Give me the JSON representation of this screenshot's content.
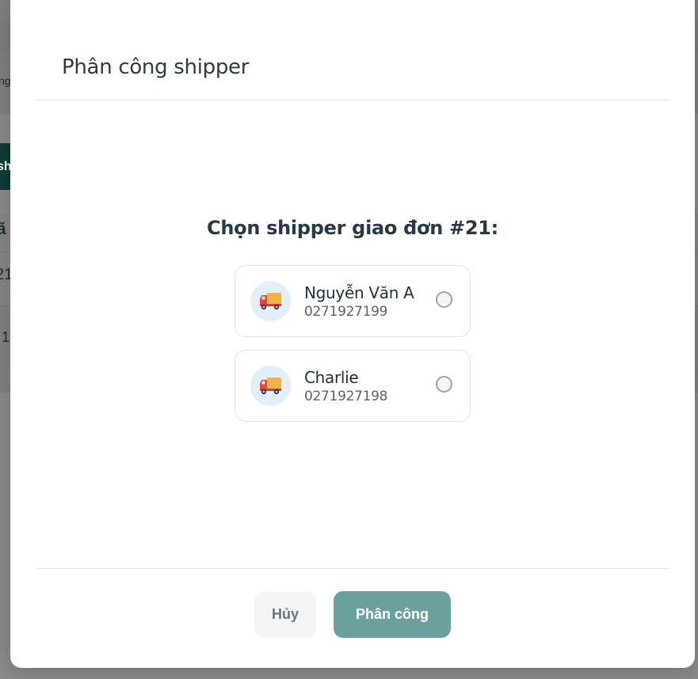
{
  "background": {
    "fragment_1": "ng",
    "fragment_2": "sh",
    "fragment_3": "ã",
    "fragment_4": "21",
    "fragment_5": "1"
  },
  "modal": {
    "title": "Phân công shipper",
    "prompt": "Chọn shipper giao đơn #21:",
    "shippers": [
      {
        "name": "Nguyễn Văn A",
        "phone": "0271927199",
        "icon": "delivery-truck-icon",
        "selected": false
      },
      {
        "name": "Charlie",
        "phone": "0271927198",
        "icon": "delivery-truck-icon",
        "selected": false
      }
    ],
    "cancel_label": "Hủy",
    "assign_label": "Phân công"
  },
  "colors": {
    "assign_button": "#6aa19c",
    "avatar_bg": "#e3eefb",
    "background_button": "#0f3d37"
  }
}
